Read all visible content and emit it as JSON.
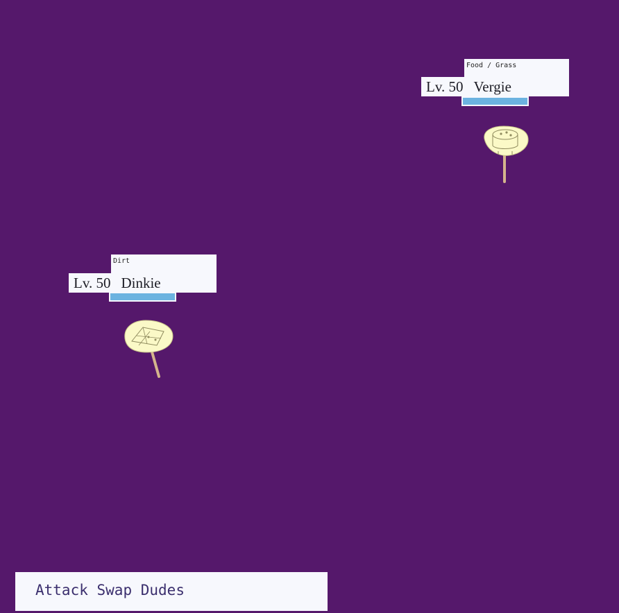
{
  "enemy": {
    "type_text": "Food / Grass",
    "level": "Lv. 50",
    "name": "Vergie",
    "hp_fraction": 1.0,
    "hp_color": "#6cb3e0"
  },
  "player": {
    "type_text": "Dirt",
    "level": "Lv. 50",
    "name": "Dinkie",
    "hp_fraction": 1.0,
    "hp_color": "#6cb3e0"
  },
  "menu": {
    "attack_label": "Attack",
    "swap_label": "Swap",
    "dudes_label": "Dudes"
  },
  "colors": {
    "background": "#55186b",
    "panel": "#f7f8fd",
    "sprite_fill": "#fbf9c7",
    "stick": "#d4b48c"
  }
}
